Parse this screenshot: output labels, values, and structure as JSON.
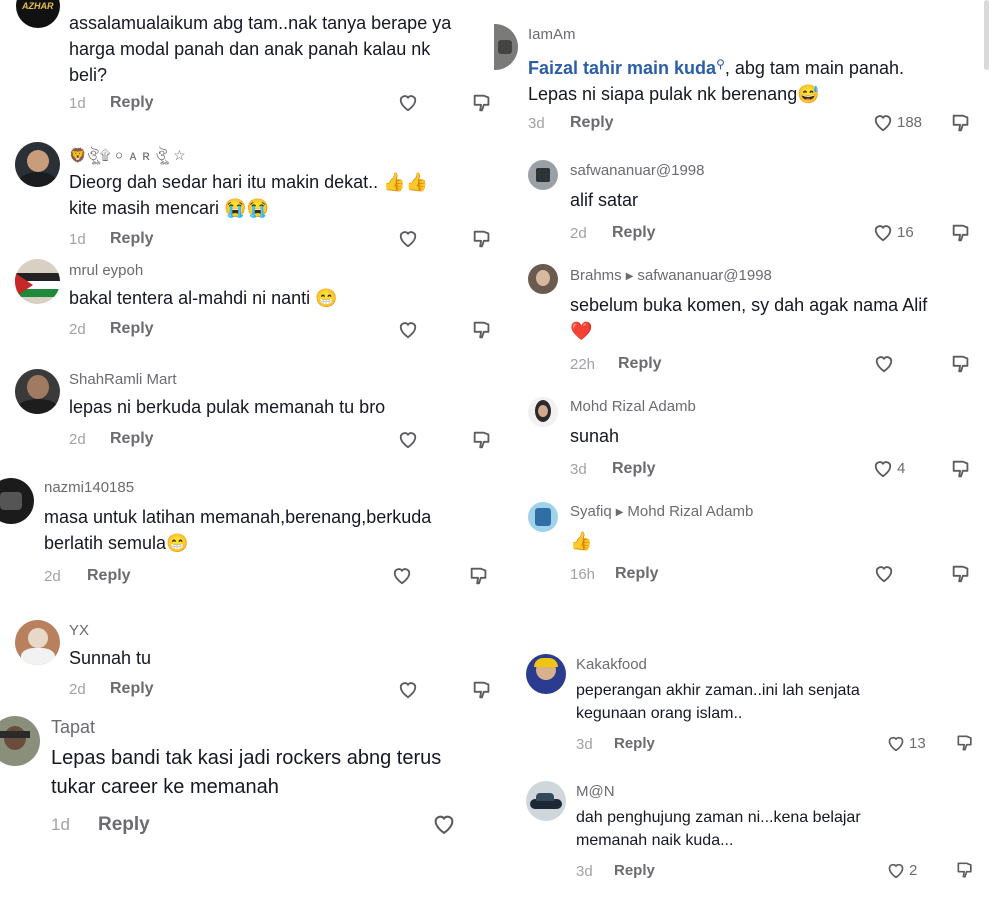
{
  "left_comments": [
    {
      "username": "",
      "text": [
        "assalamualaikum abg tam..nak tanya berape ya",
        "harga modal panah dan anak panah kalau nk",
        "beli?"
      ],
      "date": "1d",
      "reply": "Reply",
      "likes": "",
      "avatar_text": "AZHAR"
    },
    {
      "username": "🦁ঔৣ۩ ০ ᴀ ʀ ঔৣ ☆",
      "text": [
        "Dieorg dah sedar hari itu makin dekat.. 👍👍",
        "kite masih mencari 😭😭"
      ],
      "date": "1d",
      "reply": "Reply",
      "likes": ""
    },
    {
      "username": "mrul eypoh",
      "text": [
        "bakal tentera al-mahdi ni nanti 😁"
      ],
      "date": "2d",
      "reply": "Reply",
      "likes": ""
    },
    {
      "username": "ShahRamli Mart",
      "text": [
        "lepas ni berkuda pulak memanah tu bro"
      ],
      "date": "2d",
      "reply": "Reply",
      "likes": ""
    },
    {
      "username": "nazmi140185",
      "text": [
        "masa untuk latihan memanah,berenang,berkuda",
        "berlatih semula😁"
      ],
      "date": "2d",
      "reply": "Reply",
      "likes": ""
    },
    {
      "username": "YX",
      "text": [
        "Sunnah tu"
      ],
      "date": "2d",
      "reply": "Reply",
      "likes": ""
    },
    {
      "username": "Tapat",
      "text": [
        "Lepas bandi tak kasi jadi rockers abng terus",
        "tukar career ke memanah"
      ],
      "date": "1d",
      "reply": "Reply",
      "likes": ""
    }
  ],
  "right_comments": [
    {
      "username": "IamAm",
      "mention": "Faizal tahir main kuda",
      "text": [
        ", abg tam main panah.",
        "Lepas ni siapa pulak nk berenang😅"
      ],
      "date": "3d",
      "reply": "Reply",
      "likes": "188"
    },
    {
      "username": "safwananuar@1998",
      "text": [
        "alif satar"
      ],
      "date": "2d",
      "reply": "Reply",
      "likes": "16"
    },
    {
      "username": "Brahms",
      "reply_to": "safwananuar@1998",
      "text": [
        "sebelum buka komen, sy dah agak nama Alif",
        "❤️"
      ],
      "date": "22h",
      "reply": "Reply",
      "likes": ""
    },
    {
      "username": "Mohd Rizal Adamb",
      "text": [
        "sunah"
      ],
      "date": "3d",
      "reply": "Reply",
      "likes": "4"
    },
    {
      "username": "Syafiq",
      "reply_to": "Mohd Rizal Adamb",
      "text": [
        "👍"
      ],
      "date": "16h",
      "reply": "Reply",
      "likes": ""
    },
    {
      "username": "Kakakfood",
      "text": [
        "peperangan akhir zaman..ini lah senjata",
        "kegunaan orang islam.."
      ],
      "date": "3d",
      "reply": "Reply",
      "likes": "13"
    },
    {
      "username": "M@N",
      "text": [
        "dah penghujung zaman ni...kena belajar",
        "memanah naik kuda..."
      ],
      "date": "3d",
      "reply": "Reply",
      "likes": "2"
    }
  ],
  "colors": {
    "text": "#161823",
    "muted": "#6b6b70",
    "date": "#a2a2a6",
    "mention": "#2b5fa8"
  }
}
